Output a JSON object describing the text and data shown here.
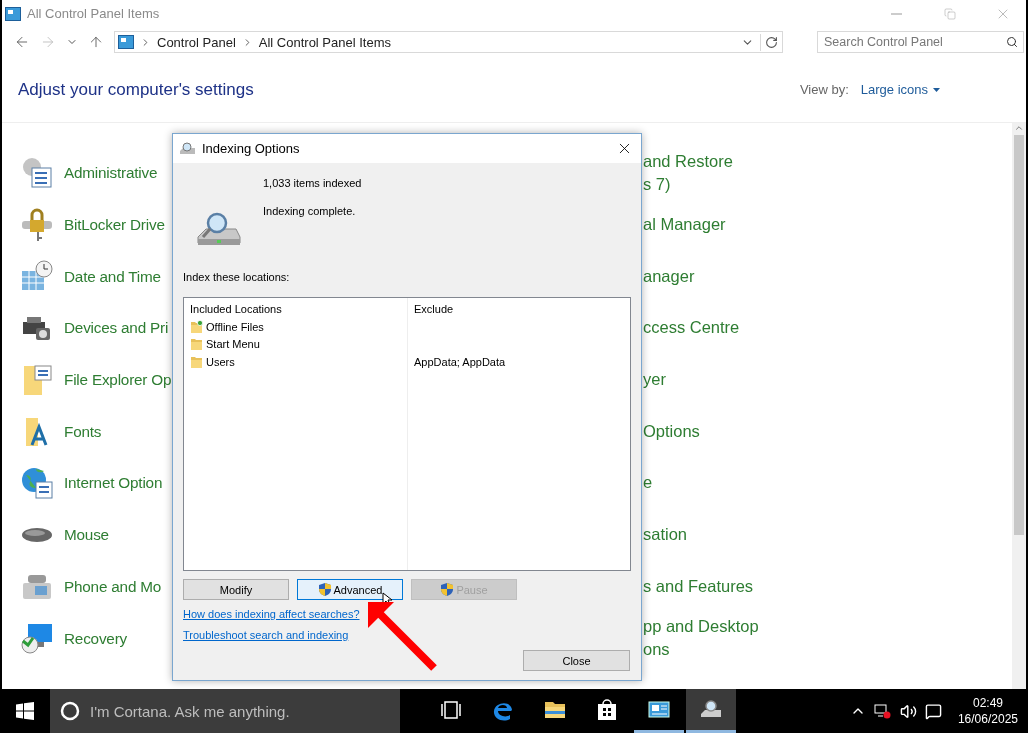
{
  "window": {
    "title": "All Control Panel Items"
  },
  "address": {
    "crumbs": [
      "Control Panel",
      "All Control Panel Items"
    ]
  },
  "search": {
    "placeholder": "Search Control Panel"
  },
  "header": {
    "title": "Adjust your computer's settings",
    "view_by_label": "View by:",
    "view_by_value": "Large icons"
  },
  "items_left": [
    {
      "label": "Administrative",
      "kind": "admin"
    },
    {
      "label": "BitLocker Drive",
      "kind": "lock"
    },
    {
      "label": "Date and Time",
      "kind": "clock"
    },
    {
      "label": "Devices and Pri",
      "kind": "printer"
    },
    {
      "label": "File Explorer Op",
      "kind": "folder-list"
    },
    {
      "label": "Fonts",
      "kind": "fonts"
    },
    {
      "label": "Internet Option",
      "kind": "globe"
    },
    {
      "label": "Mouse",
      "kind": "mouse"
    },
    {
      "label": "Phone and Mo",
      "kind": "phone"
    },
    {
      "label": "Recovery",
      "kind": "recovery"
    }
  ],
  "items_right": [
    {
      "lines": [
        "and Restore",
        "s 7)"
      ]
    },
    {
      "lines": [
        "al Manager"
      ]
    },
    {
      "lines": [
        "anager"
      ]
    },
    {
      "lines": [
        "ccess Centre"
      ]
    },
    {
      "lines": [
        "yer"
      ]
    },
    {
      "lines": [
        "Options"
      ]
    },
    {
      "lines": [
        "e"
      ]
    },
    {
      "lines": [
        "sation"
      ]
    },
    {
      "lines": [
        "s and Features"
      ]
    },
    {
      "lines": [
        "pp and Desktop",
        "ons"
      ]
    }
  ],
  "dialog": {
    "title": "Indexing Options",
    "items_indexed": "1,033 items indexed",
    "status": "Indexing complete.",
    "locations_label": "Index these locations:",
    "columns": [
      "Included Locations",
      "Exclude"
    ],
    "rows": [
      {
        "location": "Offline Files",
        "exclude": "",
        "kind": "synced-folder"
      },
      {
        "location": "Start Menu",
        "exclude": "",
        "kind": "folder"
      },
      {
        "location": "Users",
        "exclude": "AppData; AppData",
        "kind": "folder"
      }
    ],
    "buttons": [
      {
        "label": "Modify",
        "shield": false,
        "highlighted": false,
        "disabled": false
      },
      {
        "label": "Advanced",
        "shield": true,
        "highlighted": true,
        "disabled": false
      },
      {
        "label": "Pause",
        "shield": true,
        "highlighted": false,
        "disabled": true
      }
    ],
    "links": [
      "How does indexing affect searches?",
      "Troubleshoot search and indexing"
    ],
    "close_button": "Close"
  },
  "taskbar": {
    "search_placeholder": "I'm Cortana. Ask me anything.",
    "apps": [
      {
        "kind": "task-view",
        "open": false,
        "selected": false
      },
      {
        "kind": "browser",
        "open": false,
        "selected": false
      },
      {
        "kind": "folder",
        "open": false,
        "selected": false
      },
      {
        "kind": "store",
        "open": false,
        "selected": false
      },
      {
        "kind": "control-panel",
        "open": true,
        "selected": false
      },
      {
        "kind": "indexing",
        "open": true,
        "selected": true
      }
    ],
    "time": "02:49",
    "date": "16/06/2025"
  }
}
